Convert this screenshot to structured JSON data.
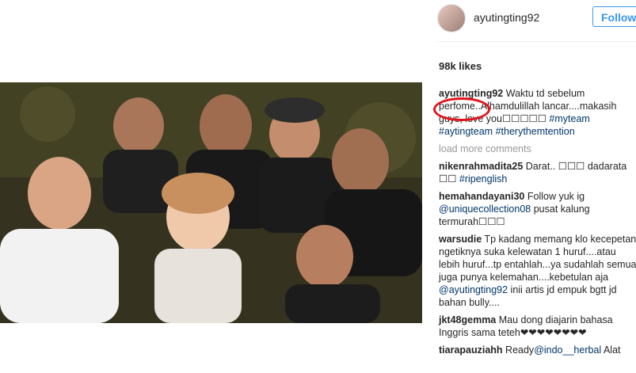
{
  "post": {
    "username": "ayutingting92",
    "follow_label": "Follow",
    "likes": "98k likes",
    "caption": {
      "user": "ayutingting92",
      "text_1": " Waktu td sebelum perfome..Alhamdulillah lancar....makasih guys, love you☐☐☐☐☐ ",
      "tag_1": "#myteam",
      "tag_2": "#aytingteam",
      "tag_3": "#therythemtention"
    },
    "load_more": "load more comments"
  },
  "comments": [
    {
      "user": "nikenrahmadita25",
      "text": " Darat.. ☐☐☐ dadarata ☐☐ ",
      "tag": "#ripenglish"
    },
    {
      "user": "hemahandayani30",
      "text_1": " Follow yuk ig ",
      "mention": "@uniquecollection08",
      "text_2": " pusat kalung termurah☐☐☐"
    },
    {
      "user": "warsudie",
      "text_1": " Tp kadang memang klo kecepetan ngetiknya suka kelewatan 1 huruf....atau lebih huruf...tp entahlah...ya sudahlah semua juga punya kelemahan....kebetulan aja ",
      "mention": "@ayutingting92",
      "text_2": " inii artis jd empuk bgtt jd bahan bully...."
    },
    {
      "user": "jkt48gemma",
      "text": " Mau dong diajarin bahasa Inggris sama teteh❤❤❤❤❤❤❤❤"
    },
    {
      "user": "tiarapauziahh",
      "text_1": " Ready",
      "mention": "@indo__herbal",
      "text_2": " Alat"
    }
  ],
  "icons": {
    "avatar": "profile-avatar",
    "highlight": "red-ellipse-annotation"
  },
  "colors": {
    "link": "#003569",
    "follow": "#3897f0",
    "annotation": "#e3131b"
  }
}
